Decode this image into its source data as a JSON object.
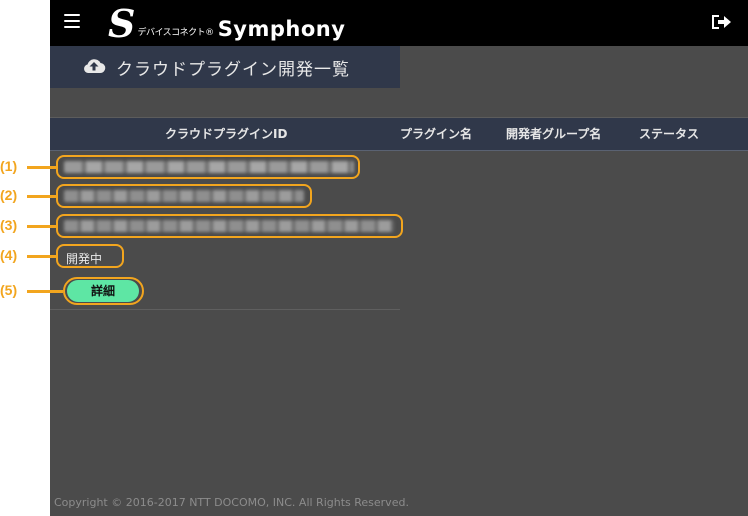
{
  "header": {
    "logo_mark": "S",
    "logo_sub": "デバイスコネクト®",
    "logo_name": "Symphony"
  },
  "page": {
    "title": "クラウドプラグイン開発一覧"
  },
  "table": {
    "columns": [
      "クラウドプラグインID",
      "プラグイン名",
      "開発者グループ名",
      "ステータス"
    ],
    "rows": [
      {
        "status": "開発中",
        "detail_label": "詳細"
      }
    ]
  },
  "annotations": [
    "(1)",
    "(2)",
    "(3)",
    "(4)",
    "(5)"
  ],
  "footer": {
    "copyright": "Copyright © 2016-2017 NTT DOCOMO, INC. All Rights Reserved."
  },
  "colors": {
    "topbar": "#000000",
    "background": "#4b4b4b",
    "header_bar": "#30384a",
    "accent_button": "#5ee6a4",
    "callout": "#f2a51e"
  }
}
